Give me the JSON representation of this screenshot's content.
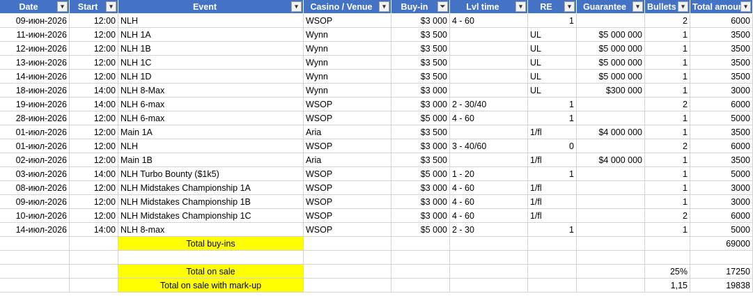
{
  "headers": [
    "Date",
    "Start",
    "Event",
    "Casino / Venue",
    "Buy-in",
    "Lvl time",
    "RE",
    "Guarantee",
    "Bullets",
    "Total amount"
  ],
  "rows": [
    [
      "09-июн-2026",
      "12:00",
      "NLH",
      "WSOP",
      "$3 000",
      "4 - 60",
      "1",
      "",
      "2",
      "6000"
    ],
    [
      "11-июн-2026",
      "12:00",
      "NLH 1A",
      "Wynn",
      "$3 500",
      "",
      "UL",
      "$5 000 000",
      "1",
      "3500"
    ],
    [
      "12-июн-2026",
      "12:00",
      "NLH 1B",
      "Wynn",
      "$3 500",
      "",
      "UL",
      "$5 000 000",
      "1",
      "3500"
    ],
    [
      "13-июн-2026",
      "12:00",
      "NLH 1C",
      "Wynn",
      "$3 500",
      "",
      "UL",
      "$5 000 000",
      "1",
      "3500"
    ],
    [
      "14-июн-2026",
      "12:00",
      "NLH 1D",
      "Wynn",
      "$3 500",
      "",
      "UL",
      "$5 000 000",
      "1",
      "3500"
    ],
    [
      "18-июн-2026",
      "14:00",
      "NLH 8-Max",
      "Wynn",
      "$3 000",
      "",
      "UL",
      "$300 000",
      "1",
      "3000"
    ],
    [
      "19-июн-2026",
      "14:00",
      "NLH 6-max",
      "WSOP",
      "$3 000",
      "2 - 30/40",
      "1",
      "",
      "2",
      "6000"
    ],
    [
      "28-июн-2026",
      "12:00",
      "NLH 6-max",
      "WSOP",
      "$5 000",
      "4 - 60",
      "1",
      "",
      "1",
      "5000"
    ],
    [
      "01-июл-2026",
      "12:00",
      "Main 1A",
      "Aria",
      "$3 500",
      "",
      "1/fl",
      "$4 000 000",
      "1",
      "3500"
    ],
    [
      "01-июл-2026",
      "12:00",
      "NLH",
      "WSOP",
      "$3 000",
      "3 - 40/60",
      "0",
      "",
      "2",
      "6000"
    ],
    [
      "02-июл-2026",
      "12:00",
      "Main 1B",
      "Aria",
      "$3 500",
      "",
      "1/fl",
      "$4 000 000",
      "1",
      "3500"
    ],
    [
      "03-июл-2026",
      "14:00",
      "NLH Turbo Bounty ($1k5)",
      "WSOP",
      "$5 000",
      "1 - 20",
      "1",
      "",
      "1",
      "5000"
    ],
    [
      "08-июл-2026",
      "12:00",
      "NLH Midstakes Championship 1A",
      "WSOP",
      "$3 000",
      "4 - 60",
      "1/fl",
      "",
      "1",
      "3000"
    ],
    [
      "09-июл-2026",
      "12:00",
      "NLH Midstakes Championship 1B",
      "WSOP",
      "$3 000",
      "4 - 60",
      "1/fl",
      "",
      "1",
      "3000"
    ],
    [
      "10-июл-2026",
      "12:00",
      "NLH Midstakes Championship 1C",
      "WSOP",
      "$3 000",
      "4 - 60",
      "1/fl",
      "",
      "2",
      "6000"
    ],
    [
      "14-июл-2026",
      "14:00",
      "NLH 8-max",
      "WSOP",
      "$5 000",
      "2 - 30",
      "1",
      "",
      "1",
      "5000"
    ]
  ],
  "summary": {
    "total_buyins_label": "Total buy-ins",
    "total_buyins_value": "69000",
    "total_on_sale_label": "Total on sale",
    "total_on_sale_pct": "25%",
    "total_on_sale_value": "17250",
    "markup_label": "Total on sale with mark-up",
    "markup_factor": "1,15",
    "markup_value": "19838"
  },
  "filter_icons": {
    "default": "▾",
    "active": "⏷"
  }
}
